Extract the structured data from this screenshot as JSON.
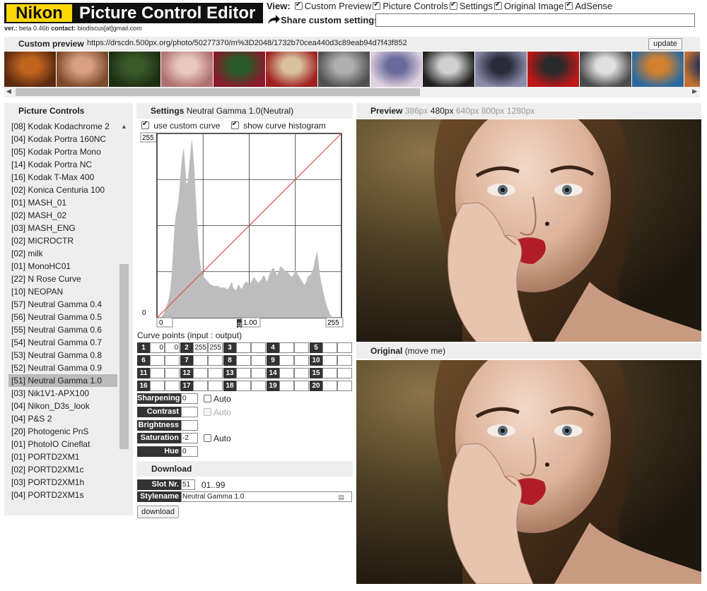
{
  "app": {
    "logo_brand": "Nikon",
    "title": "Picture Control Editor",
    "ver_label": "ver.:",
    "ver_value": "beta 0.46b",
    "contact_label": "contact:",
    "contact_value": "biodiscus[at]gmail.com"
  },
  "view": {
    "label": "View:",
    "options": [
      {
        "label": "Custom Preview",
        "checked": true
      },
      {
        "label": "Picture Controls",
        "checked": true
      },
      {
        "label": "Settings",
        "checked": true
      },
      {
        "label": "Original Image",
        "checked": true
      },
      {
        "label": "AdSense",
        "checked": true
      }
    ]
  },
  "share": {
    "label": "Share custom settings",
    "value": ""
  },
  "custom_preview": {
    "label": "Custom preview",
    "url": "https://drscdn.500px.org/photo/50277370/m%3D2048/1732b70cea440d3c89eab94d7f43f852",
    "update_label": "update",
    "thumb_colors": [
      [
        "#c0641e",
        "#5a2a10"
      ],
      [
        "#d8a080",
        "#7a4a2a"
      ],
      [
        "#3a5a2a",
        "#1e2e14"
      ],
      [
        "#e8c8c0",
        "#b07070"
      ],
      [
        "#2a5a2a",
        "#8a1a2a"
      ],
      [
        "#d8c0a0",
        "#a02020"
      ],
      [
        "#b0b0b0",
        "#505050"
      ],
      [
        "#6a6a9a",
        "#e0d0e0"
      ],
      [
        "#d0d0d0",
        "#202020"
      ],
      [
        "#2a2a3a",
        "#8a8aaa"
      ],
      [
        "#2a2a2a",
        "#c01818"
      ],
      [
        "#e0e0e0",
        "#4a4a4a"
      ],
      [
        "#d08030",
        "#2a6aa0"
      ],
      [
        "#1a2a5a",
        "#c07030"
      ],
      [
        "#f0d0e0",
        "#c05080"
      ]
    ]
  },
  "picture_controls": {
    "title": "Picture Controls",
    "items": [
      "[08] Kodak Kodachrome 2",
      "[04] Kodak Portra 160NC",
      "[05] Kodak Portra Mono",
      "[14] Kodak Portra NC",
      "[16] Kodak T-Max 400",
      "[02] Konica Centuria 100",
      "[01] MASH_01",
      "[02] MASH_02",
      "[03] MASH_ENG",
      "[02] MICROCTR",
      "[02] milk",
      "[01] MonoHC01",
      "[22] N Rose Curve",
      "[10] NEOPAN",
      "[57] Neutral Gamma 0.4",
      "[56] Neutral Gamma 0.5",
      "[55] Neutral Gamma 0.6",
      "[54] Neutral Gamma 0.7",
      "[53] Neutral Gamma 0.8",
      "[52] Neutral Gamma 0.9",
      "[51] Neutral Gamma 1.0",
      "[03] Nik1V1-APX100",
      "[04] Nikon_D3s_look",
      "[04] P&S 2",
      "[20] Photogenic PnS",
      "[01] PhotoIO Cineflat",
      "[01] PORTD2XM1",
      "[02] PORTD2XM1c",
      "[03] PORTD2XM1h",
      "[04] PORTD2XM1s"
    ],
    "selected_index": 20
  },
  "settings": {
    "title": "Settings",
    "name": "Neutral Gamma 1.0(Neutral)",
    "use_custom_curve": {
      "label": "use custom curve",
      "checked": true
    },
    "show_histogram": {
      "label": "show curve histogram",
      "checked": true
    },
    "curve": {
      "y_max_label": "255",
      "y_min_label": "0",
      "x_min_label": "0",
      "x_max_label": "255",
      "gamma_marker": "g",
      "gamma_value": "1.00",
      "points": [
        [
          0,
          0
        ],
        [
          255,
          255
        ]
      ],
      "histogram": [
        0,
        2,
        3,
        5,
        8,
        10,
        14,
        20,
        30,
        45,
        60,
        68,
        72,
        78,
        88,
        100,
        108,
        112,
        100,
        88,
        90,
        100,
        110,
        118,
        110,
        96,
        80,
        62,
        48,
        38,
        32,
        29,
        27,
        26,
        25,
        24,
        23,
        22,
        22,
        21,
        21,
        21,
        21,
        21,
        20,
        20,
        20,
        20,
        20,
        19,
        19,
        20,
        22,
        24,
        20,
        19,
        18,
        20,
        22,
        21,
        19,
        20,
        22,
        23,
        24,
        23,
        22,
        23,
        24,
        26,
        27,
        25,
        24,
        23,
        24,
        25,
        27,
        28,
        27,
        24,
        25,
        28,
        30,
        32,
        33,
        32,
        30,
        28,
        30,
        33,
        34,
        33,
        32,
        31,
        30,
        30,
        29,
        28,
        27,
        28,
        30,
        32,
        30,
        28,
        27,
        25,
        24,
        22,
        22,
        24,
        27,
        28,
        28,
        30,
        32,
        36,
        40,
        44,
        38,
        30,
        24,
        20,
        16,
        12,
        9,
        6,
        4,
        2,
        1,
        0
      ]
    },
    "curve_points_label": "Curve points (input : output)",
    "curve_points": [
      {
        "n": "1",
        "in": "0",
        "out": "0"
      },
      {
        "n": "2",
        "in": "255",
        "out": "255"
      },
      {
        "n": "3",
        "in": "",
        "out": ""
      },
      {
        "n": "4",
        "in": "",
        "out": ""
      },
      {
        "n": "5",
        "in": "",
        "out": ""
      },
      {
        "n": "6",
        "in": "",
        "out": ""
      },
      {
        "n": "7",
        "in": "",
        "out": ""
      },
      {
        "n": "8",
        "in": "",
        "out": ""
      },
      {
        "n": "9",
        "in": "",
        "out": ""
      },
      {
        "n": "10",
        "in": "",
        "out": ""
      },
      {
        "n": "11",
        "in": "",
        "out": ""
      },
      {
        "n": "12",
        "in": "",
        "out": ""
      },
      {
        "n": "13",
        "in": "",
        "out": ""
      },
      {
        "n": "14",
        "in": "",
        "out": ""
      },
      {
        "n": "15",
        "in": "",
        "out": ""
      },
      {
        "n": "16",
        "in": "",
        "out": ""
      },
      {
        "n": "17",
        "in": "",
        "out": ""
      },
      {
        "n": "18",
        "in": "",
        "out": ""
      },
      {
        "n": "19",
        "in": "",
        "out": ""
      },
      {
        "n": "20",
        "in": "",
        "out": ""
      }
    ],
    "sharpening": {
      "label": "Sharpening",
      "value": "0",
      "auto_label": "Auto",
      "auto_checked": false
    },
    "contrast": {
      "label": "Contrast",
      "value": "",
      "auto_label": "Auto",
      "auto_checked": false
    },
    "brightness": {
      "label": "Brightness",
      "value": ""
    },
    "saturation": {
      "label": "Saturation",
      "value": "-2",
      "auto_label": "Auto",
      "auto_checked": false
    },
    "hue": {
      "label": "Hue",
      "value": "0"
    }
  },
  "download": {
    "title": "Download",
    "slot_label": "Slot Nr.",
    "slot_value": "51",
    "slot_range": "01..99",
    "stylename_label": "Stylename",
    "stylename_value": "Neutral Gamma 1.0",
    "button_label": "download"
  },
  "preview": {
    "title": "Preview",
    "sizes": [
      "386px",
      "480px",
      "640px",
      "800px",
      "1280px"
    ],
    "active_size": "480px"
  },
  "original": {
    "title": "Original",
    "hint": "(move me)"
  }
}
